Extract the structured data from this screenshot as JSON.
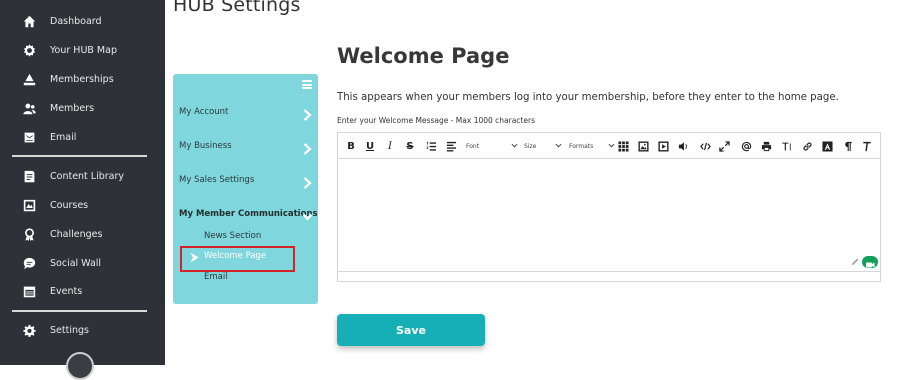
{
  "sidebar": {
    "items": [
      {
        "label": "Dashboard",
        "icon": "home-icon"
      },
      {
        "label": "Your HUB Map",
        "icon": "hub-map-icon"
      },
      {
        "label": "Memberships",
        "icon": "memberships-icon"
      },
      {
        "label": "Members",
        "icon": "members-icon"
      },
      {
        "label": "Email",
        "icon": "email-icon"
      },
      {
        "label": "Content Library",
        "icon": "content-library-icon"
      },
      {
        "label": "Courses",
        "icon": "courses-icon"
      },
      {
        "label": "Challenges",
        "icon": "challenges-icon"
      },
      {
        "label": "Social Wall",
        "icon": "social-wall-icon"
      },
      {
        "label": "Events",
        "icon": "events-icon"
      },
      {
        "label": "Settings",
        "icon": "gear-icon"
      }
    ]
  },
  "page": {
    "title": "HUB Settings"
  },
  "settings_menu": {
    "items": [
      {
        "label": "My Account"
      },
      {
        "label": "My Business"
      },
      {
        "label": "My Sales Settings"
      },
      {
        "label": "My Member Communications"
      }
    ],
    "sub_items": [
      {
        "label": "News Section"
      },
      {
        "label": "Welcome Page"
      },
      {
        "label": "Email"
      }
    ],
    "active_sub_item": "Welcome Page"
  },
  "main": {
    "heading": "Welcome Page",
    "description": "This appears when your members log into your membership, before they enter to the home page.",
    "field_label": "Enter your Welcome Message - Max 1000 characters",
    "message_value": "",
    "toolbar": {
      "bold": "B",
      "underline": "U",
      "italic": "I",
      "strikethrough": "S",
      "font_select": "Font",
      "size_select": "Size",
      "formats_select": "Formats"
    },
    "save_label": "Save"
  },
  "colors": {
    "sidebar_bg": "#2e3238",
    "settings_menu_bg": "#7fd6dc",
    "accent": "#17afb6",
    "highlight_border": "#d2232a"
  }
}
